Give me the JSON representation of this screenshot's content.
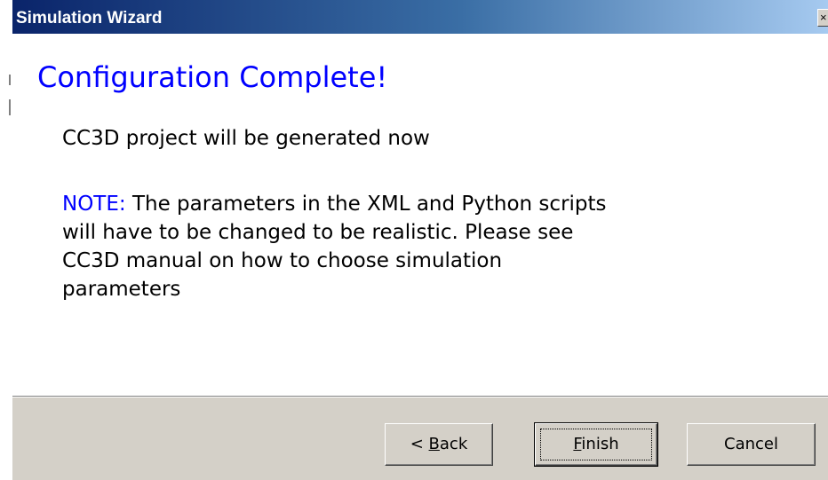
{
  "window": {
    "title": "Simulation Wizard",
    "close_glyph": "×"
  },
  "page": {
    "heading": "Configuration Complete!",
    "line1": "CC3D project will be generated now",
    "note_label": "NOTE:",
    "note_lines": [
      " The parameters in the XML and Python scripts",
      "will have to be changed to be realistic. Please see",
      "CC3D manual on how to choose simulation",
      "parameters"
    ]
  },
  "buttons": {
    "back": {
      "prefix": "< ",
      "mnemonic": "B",
      "rest": "ack"
    },
    "finish": {
      "mnemonic": "F",
      "rest": "inish"
    },
    "cancel": {
      "label": "Cancel"
    }
  },
  "colors": {
    "heading": "#0000ff",
    "note_label": "#0000ff",
    "face": "#d4d0c8",
    "titlebar_start": "#0a246a",
    "titlebar_end": "#a6caf0"
  },
  "icons": {
    "close": "close-icon"
  }
}
